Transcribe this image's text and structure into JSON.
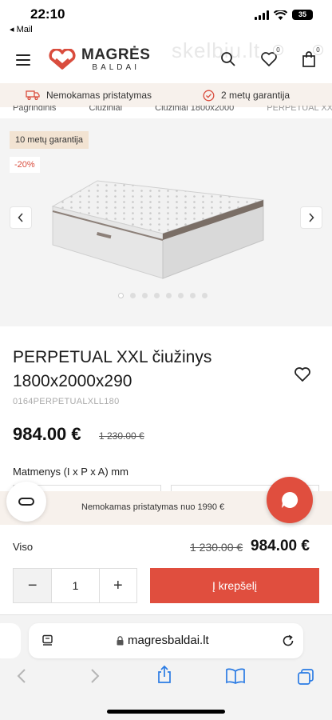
{
  "status": {
    "time": "22:10",
    "back_app": "◂ Mail",
    "battery": "35"
  },
  "header": {
    "logo_name": "MAGRĖS",
    "logo_sub": "BALDAI",
    "watermark": "skelbiu.lt",
    "wishlist_count": "0",
    "cart_count": "0"
  },
  "info_strip": {
    "shipping": "Nemokamas pristatymas",
    "warranty": "2 metų garantija"
  },
  "breadcrumb": [
    "Pagrindinis",
    "Čiužiniai",
    "Čiužiniai 1800x2000",
    "PERPETUAL XX"
  ],
  "gallery": {
    "guarantee_tag": "10 metų garantija",
    "discount_tag": "-20%",
    "slide_count": 8,
    "active_slide": 1
  },
  "product": {
    "title": "PERPETUAL XXL čiužinys 1800x2000x290",
    "sku": "0164PERPETUALXLL180",
    "price": "984.00 €",
    "old_price": "1 230.00 €",
    "dimensions_label": "Matmenys (I x P x A) mm"
  },
  "promo": {
    "text": "Nemokamas pristatymas nuo 1990 €"
  },
  "total": {
    "label": "Viso",
    "old_price": "1 230.00 €",
    "price": "984.00 €"
  },
  "cart": {
    "quantity": "1",
    "minus": "−",
    "plus": "+",
    "add_label": "Į krepšelį"
  },
  "browser": {
    "url": "magresbaldai.lt"
  },
  "colors": {
    "accent": "#e04e3e",
    "strip_bg": "#f7f1ec",
    "tag_bg": "#f2e3d2"
  }
}
